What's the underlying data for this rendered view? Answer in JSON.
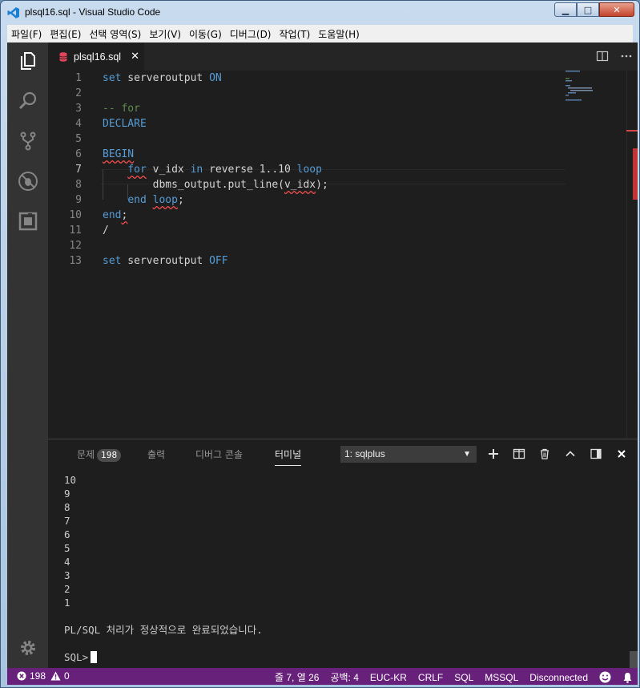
{
  "window": {
    "title": "plsql16.sql - Visual Studio Code",
    "min": "▁",
    "max": "□",
    "close": "✕"
  },
  "menu": [
    "파일(F)",
    "편집(E)",
    "선택 영역(S)",
    "보기(V)",
    "이동(G)",
    "디버그(D)",
    "작업(T)",
    "도움말(H)"
  ],
  "activity": [
    "files-icon",
    "search-icon",
    "source-control-icon",
    "debug-icon",
    "extensions-icon",
    "settings-gear-icon"
  ],
  "tab": {
    "label": "plsql16.sql",
    "close": "✕"
  },
  "editor": {
    "active_line": 7,
    "lines": [
      {
        "n": "1",
        "parts": [
          [
            "kw",
            "set"
          ],
          [
            "t",
            " serveroutput "
          ],
          [
            "kw",
            "ON"
          ]
        ]
      },
      {
        "n": "2",
        "parts": []
      },
      {
        "n": "3",
        "parts": [
          [
            "cm",
            "-- for"
          ]
        ]
      },
      {
        "n": "4",
        "parts": [
          [
            "kw",
            "DECLARE"
          ]
        ]
      },
      {
        "n": "5",
        "parts": []
      },
      {
        "n": "6",
        "parts": [
          [
            "kwsq",
            "BEGIN"
          ]
        ]
      },
      {
        "n": "7",
        "parts": [
          [
            "t",
            "    "
          ],
          [
            "kwsq",
            "for"
          ],
          [
            "t",
            " v_idx "
          ],
          [
            "kw",
            "in"
          ],
          [
            "t",
            " reverse 1..10 "
          ],
          [
            "kw",
            "loop"
          ]
        ]
      },
      {
        "n": "8",
        "parts": [
          [
            "t",
            "        dbms_output.put_line("
          ],
          [
            "sq",
            "v_idx"
          ],
          [
            "t",
            ");"
          ]
        ]
      },
      {
        "n": "9",
        "parts": [
          [
            "t",
            "    "
          ],
          [
            "kw",
            "end"
          ],
          [
            "t",
            " "
          ],
          [
            "kwsq",
            "loop"
          ],
          [
            "t",
            ";"
          ]
        ]
      },
      {
        "n": "10",
        "parts": [
          [
            "kw",
            "end"
          ],
          [
            "sq",
            ";"
          ]
        ]
      },
      {
        "n": "11",
        "parts": [
          [
            "t",
            "/"
          ]
        ]
      },
      {
        "n": "12",
        "parts": []
      },
      {
        "n": "13",
        "parts": [
          [
            "kw",
            "set"
          ],
          [
            "t",
            " serveroutput "
          ],
          [
            "kw",
            "OFF"
          ]
        ]
      }
    ]
  },
  "panel": {
    "tabs": {
      "problems": "문제",
      "problems_count": "198",
      "output": "출력",
      "debug_console": "디버그 콘솔",
      "terminal": "터미널"
    },
    "terminal_select": "1: sqlplus",
    "terminal_lines": [
      "10",
      "9",
      "8",
      "7",
      "6",
      "5",
      "4",
      "3",
      "2",
      "1",
      "",
      "PL/SQL 처리가 정상적으로 완료되었습니다.",
      "",
      "SQL>"
    ]
  },
  "status": {
    "errors": "198",
    "warnings": "0",
    "position": "줄 7, 열 26",
    "spaces": "공백: 4",
    "encoding": "EUC-KR",
    "eol": "CRLF",
    "language": "SQL",
    "connection_type": "MSSQL",
    "connection_state": "Disconnected"
  }
}
